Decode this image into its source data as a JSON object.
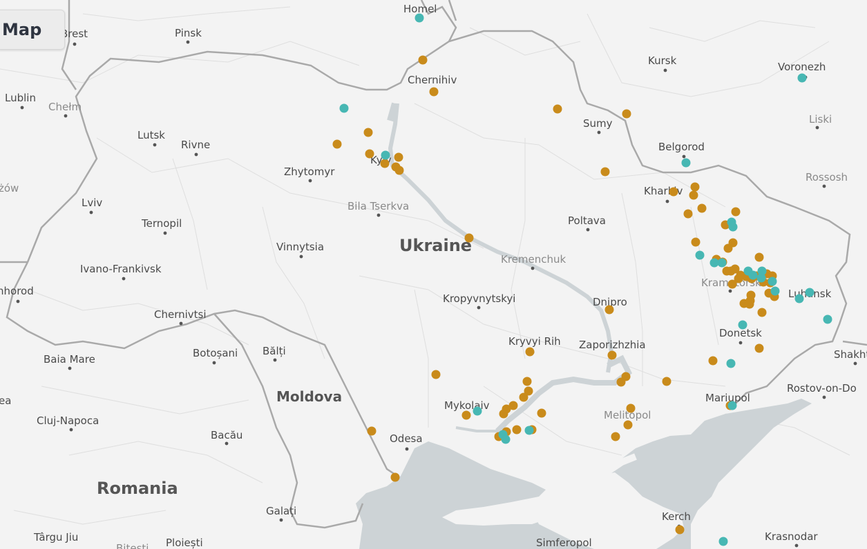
{
  "ui": {
    "map_button": "Map"
  },
  "colors": {
    "land": "#f3f3f3",
    "water": "#cdd3d6",
    "border": "#a7a7a7",
    "admin": "#dddddd",
    "event_orange": "#c98b1b",
    "event_teal": "#47b7b3"
  },
  "countries": [
    "Ukraine",
    "Moldova",
    "Romania"
  ],
  "cities": [
    "Homel",
    "Brest",
    "Pinsk",
    "Kursk",
    "Voronezh",
    "Chernihiv",
    "Lublin",
    "Chełm",
    "Sumy",
    "Lutsk",
    "Rivne",
    "Belgorod",
    "Liski",
    "Zhytomyr",
    "Kyiv",
    "Kharkiv",
    "Rossosh",
    "żów",
    "Lviv",
    "Bila Tserkva",
    "Ternopil",
    "Poltava",
    "Vinnytsia",
    "Kremenchuk",
    "Ivano-Frankivsk",
    "Kramatorsk",
    "Luhansk",
    "nhorod",
    "Kropyvnytskyi",
    "Dnipro",
    "Chernivtsi",
    "Donetsk",
    "Kryvyi Rih",
    "Zaporizhzhia",
    "Shakht",
    "Baia Mare",
    "Botoșani",
    "Bălți",
    "Moldova",
    "Rostov-on-Do",
    "Mykolaiv",
    "Mariupol",
    "ea",
    "Cluj-Napoca",
    "Melitopol",
    "Bacău",
    "Odesa",
    "Galați",
    "Kerch",
    "Târgu Jiu",
    "Ploiești",
    "Simferopol",
    "Krasnodar",
    "Bitesti"
  ],
  "events": [
    {
      "type": "orange",
      "count": 86
    },
    {
      "type": "teal",
      "count": 27
    }
  ]
}
